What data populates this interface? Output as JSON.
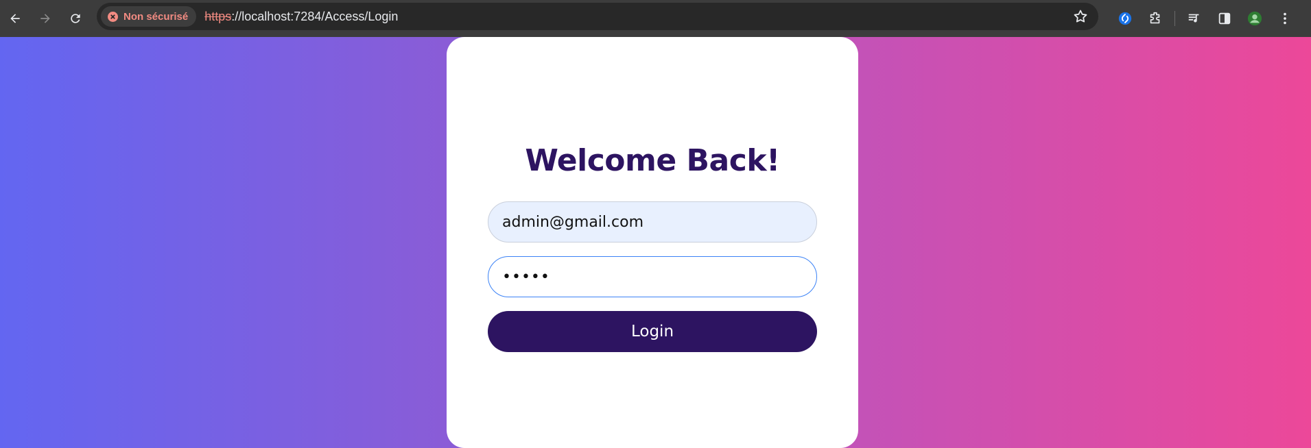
{
  "browser": {
    "security_label": "Non sécurisé",
    "url_scheme": "https",
    "url_rest": "://localhost:7284/Access/Login",
    "icons": [
      "back-icon",
      "forward-icon",
      "reload-icon",
      "star-icon",
      "shazam-extension-icon",
      "extensions-icon",
      "media-controls-icon",
      "side-panel-icon",
      "profile-avatar-icon",
      "menu-icon"
    ]
  },
  "login": {
    "title": "Welcome Back!",
    "email_value": "admin@gmail.com",
    "password_value": "•••••",
    "button_label": "Login"
  },
  "colors": {
    "title": "#2d1461",
    "button": "#2d1461",
    "gradient_start": "#6366f1",
    "gradient_end": "#ec4899",
    "insecure": "#f28b82"
  }
}
